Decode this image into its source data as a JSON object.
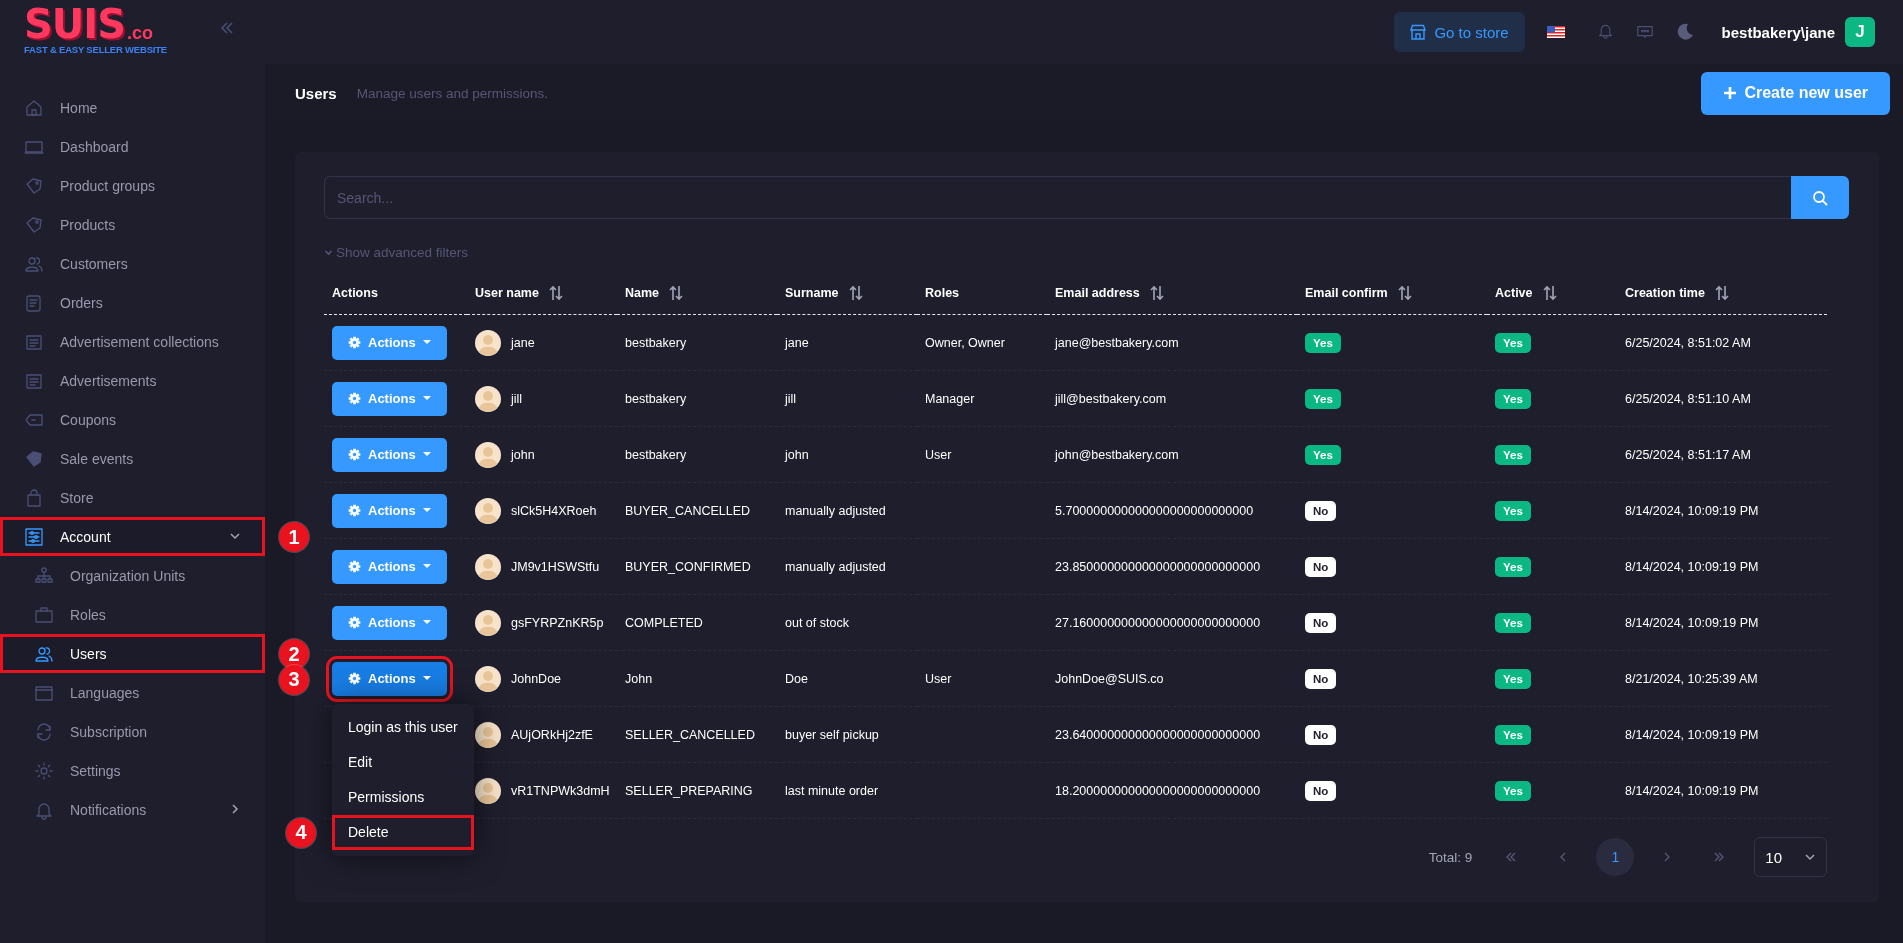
{
  "logo": {
    "name": "SUIS",
    "suffix": ".co",
    "tagline": "FAST & EASY SELLER WEBSITE"
  },
  "sidebar": {
    "items": [
      {
        "label": "Home",
        "selected": false
      },
      {
        "label": "Dashboard",
        "selected": false
      },
      {
        "label": "Product groups",
        "selected": false
      },
      {
        "label": "Products",
        "selected": false
      },
      {
        "label": "Customers",
        "selected": false
      },
      {
        "label": "Orders",
        "selected": false
      },
      {
        "label": "Advertisement collections",
        "selected": false
      },
      {
        "label": "Advertisements",
        "selected": false
      },
      {
        "label": "Coupons",
        "selected": false
      },
      {
        "label": "Sale events",
        "selected": false
      },
      {
        "label": "Store",
        "selected": false
      },
      {
        "label": "Account",
        "selected": true,
        "expanded": true,
        "annotation": "1",
        "children": [
          {
            "label": "Organization Units",
            "selected": false
          },
          {
            "label": "Roles",
            "selected": false
          },
          {
            "label": "Users",
            "selected": true,
            "annotation": "2"
          },
          {
            "label": "Languages",
            "selected": false
          },
          {
            "label": "Subscription",
            "selected": false
          },
          {
            "label": "Settings",
            "selected": false
          },
          {
            "label": "Notifications",
            "selected": false,
            "expanded": false
          }
        ]
      }
    ]
  },
  "header": {
    "store_button": "Go to store",
    "user": "bestbakery\\jane",
    "avatar": "J"
  },
  "page": {
    "title": "Users",
    "subtitle": "Manage users and permissions.",
    "create_button": "Create new user"
  },
  "search": {
    "placeholder": "Search..."
  },
  "filters_link": "Show advanced filters",
  "table": {
    "columns": [
      {
        "label": "Actions",
        "sortable": false
      },
      {
        "label": "User name",
        "sortable": true
      },
      {
        "label": "Name",
        "sortable": true
      },
      {
        "label": "Surname",
        "sortable": true
      },
      {
        "label": "Roles",
        "sortable": false
      },
      {
        "label": "Email address",
        "sortable": true
      },
      {
        "label": "Email confirm",
        "sortable": true
      },
      {
        "label": "Active",
        "sortable": true
      },
      {
        "label": "Creation time",
        "sortable": true
      }
    ],
    "rows": [
      {
        "actions": {
          "label": "Actions",
          "open": false
        },
        "user_name": "jane",
        "name": "bestbakery",
        "surname": "jane",
        "roles": "Owner, Owner",
        "email_address": "jane@bestbakery.com",
        "email_confirm": {
          "text": "Yes",
          "on": true
        },
        "active": {
          "text": "Yes",
          "on": true
        },
        "creation_time": "6/25/2024, 8:51:02 AM"
      },
      {
        "actions": {
          "label": "Actions",
          "open": false
        },
        "user_name": "jill",
        "name": "bestbakery",
        "surname": "jill",
        "roles": "Manager",
        "email_address": "jill@bestbakery.com",
        "email_confirm": {
          "text": "Yes",
          "on": true
        },
        "active": {
          "text": "Yes",
          "on": true
        },
        "creation_time": "6/25/2024, 8:51:10 AM"
      },
      {
        "actions": {
          "label": "Actions",
          "open": false
        },
        "user_name": "john",
        "name": "bestbakery",
        "surname": "john",
        "roles": "User",
        "email_address": "john@bestbakery.com",
        "email_confirm": {
          "text": "Yes",
          "on": true
        },
        "active": {
          "text": "Yes",
          "on": true
        },
        "creation_time": "6/25/2024, 8:51:17 AM"
      },
      {
        "actions": {
          "label": "Actions",
          "open": false
        },
        "user_name": "slCk5H4XRoeh",
        "name": "BUYER_CANCELLED",
        "surname": "manually adjusted",
        "email_address": "5.700000000000000000000000000",
        "email_confirm": {
          "text": "No",
          "on": false
        },
        "active": {
          "text": "Yes",
          "on": true
        },
        "creation_time": "8/14/2024, 10:09:19 PM"
      },
      {
        "actions": {
          "label": "Actions",
          "open": false
        },
        "user_name": "JM9v1HSWStfu",
        "name": "BUYER_CONFIRMED",
        "surname": "manually adjusted",
        "email_address": "23.850000000000000000000000000",
        "email_confirm": {
          "text": "No",
          "on": false
        },
        "active": {
          "text": "Yes",
          "on": true
        },
        "creation_time": "8/14/2024, 10:09:19 PM"
      },
      {
        "actions": {
          "label": "Actions",
          "open": false
        },
        "user_name": "gsFYRPZnKR5p",
        "name": "COMPLETED",
        "surname": "out of stock",
        "email_address": "27.160000000000000000000000000",
        "email_confirm": {
          "text": "No",
          "on": false
        },
        "active": {
          "text": "Yes",
          "on": true
        },
        "creation_time": "8/14/2024, 10:09:19 PM"
      },
      {
        "actions": {
          "label": "Actions",
          "open": true,
          "annotation": "3",
          "menu": [
            {
              "label": "Login as this user"
            },
            {
              "label": "Edit"
            },
            {
              "label": "Permissions"
            },
            {
              "label": "Delete",
              "annotation": "4"
            }
          ]
        },
        "user_name": "JohnDoe",
        "name": "John",
        "surname": "Doe",
        "roles": "User",
        "email_address": "JohnDoe@SUIS.co",
        "email_confirm": {
          "text": "No",
          "on": false
        },
        "active": {
          "text": "Yes",
          "on": true
        },
        "creation_time": "8/21/2024, 10:25:39 AM"
      },
      {
        "user_name": "AUjORkHj2zfE",
        "name": "SELLER_CANCELLED",
        "surname": "buyer self pickup",
        "email_address": "23.640000000000000000000000000",
        "email_confirm": {
          "text": "No",
          "on": false
        },
        "active": {
          "text": "Yes",
          "on": true
        },
        "creation_time": "8/14/2024, 10:09:19 PM"
      },
      {
        "user_name": "vR1TNPWk3dmH",
        "name": "SELLER_PREPARING",
        "surname": "last minute order",
        "email_address": "18.200000000000000000000000000",
        "email_confirm": {
          "text": "No",
          "on": false
        },
        "active": {
          "text": "Yes",
          "on": true
        },
        "creation_time": "8/14/2024, 10:09:19 PM"
      }
    ]
  },
  "pagination": {
    "total": "Total: 9",
    "pages": [
      {
        "label": "1",
        "selected": true
      }
    ],
    "page_size": "10"
  }
}
